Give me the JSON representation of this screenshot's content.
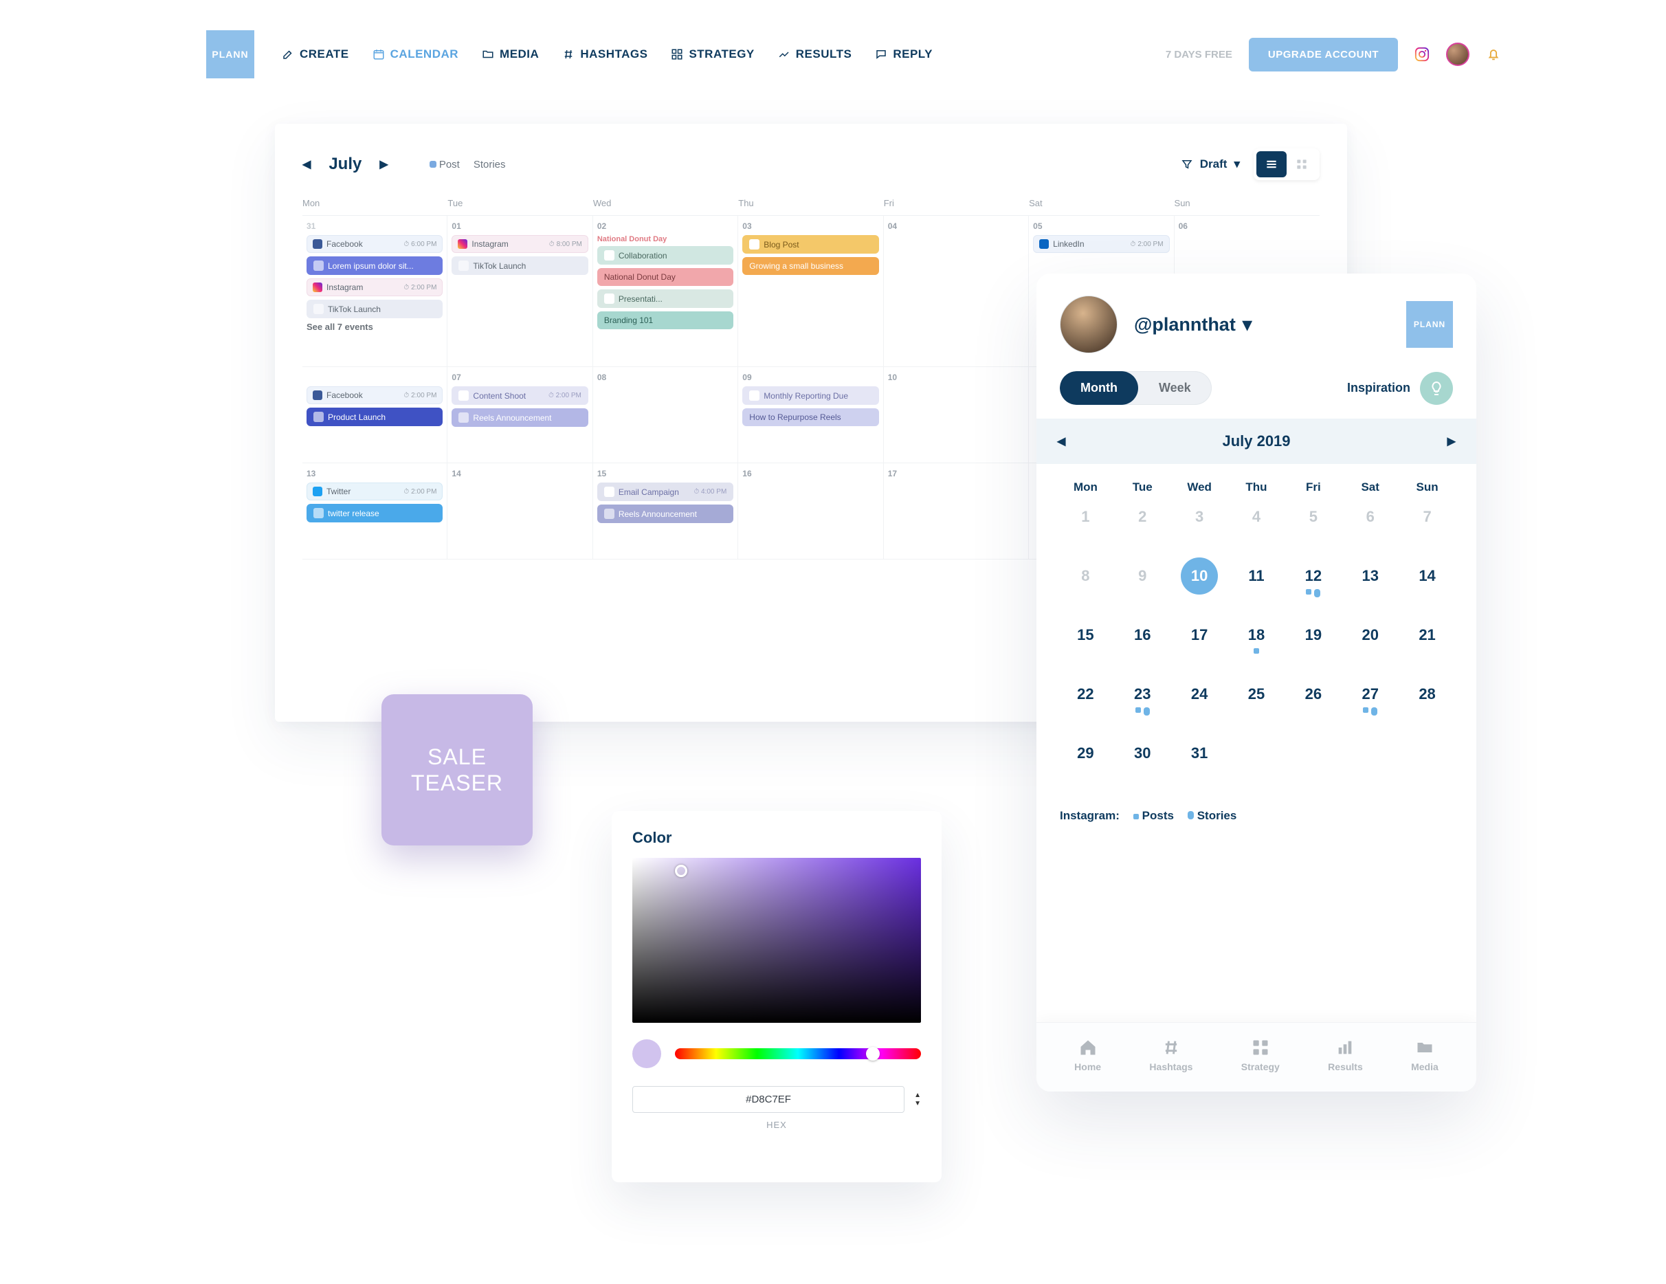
{
  "brand": "PLANN",
  "nav": {
    "create": "CREATE",
    "calendar": "CALENDAR",
    "media": "MEDIA",
    "hashtags": "HASHTAGS",
    "strategy": "STRATEGY",
    "results": "RESULTS",
    "reply": "REPLY"
  },
  "trial_prefix": "7 DAYS",
  "trial_suffix": "FREE",
  "upgrade": "UPGRADE ACCOUNT",
  "calendar": {
    "month_label": "July",
    "legend_post": "Post",
    "legend_stories": "Stories",
    "filter_label": "Draft",
    "weekdays": [
      "Mon",
      "Tue",
      "Wed",
      "Thu",
      "Fri",
      "Sat",
      "Sun"
    ],
    "see_all": "See all 7 events"
  },
  "cells": {
    "d31": "31",
    "d01": "01",
    "d02": "02",
    "d03": "03",
    "d04": "04",
    "d05": "05",
    "d06": "06",
    "d07": "07",
    "d08": "08",
    "d09": "09",
    "d10": "10",
    "d13": "13",
    "d14": "14",
    "d15": "15",
    "d16": "16",
    "d17": "17"
  },
  "events": {
    "fb1": "Facebook",
    "fb1_t": "6:00 PM",
    "lorem": "Lorem ipsum dolor sit...",
    "ig1": "Instagram",
    "ig1_t": "2:00 PM",
    "tiktok1": "TikTok Launch",
    "ig2": "Instagram",
    "ig2_t": "8:00 PM",
    "tiktok2": "TikTok Launch",
    "holiday": "National Donut Day",
    "collab": "Collaboration",
    "donut_pill": "National Donut Day",
    "present": "Presentati...",
    "brand101": "Branding 101",
    "blog": "Blog Post",
    "grow": "Growing a small business",
    "li": "LinkedIn",
    "li_t": "2:00 PM",
    "fb2": "Facebook",
    "fb2_t": "2:00 PM",
    "product_launch": "Product Launch",
    "shoot": "Content Shoot",
    "shoot_t": "2:00 PM",
    "reels1": "Reels Announcement",
    "monthly": "Monthly Reporting Due",
    "repurpose": "How to Repurpose Reels",
    "tw": "Twitter",
    "tw_t": "2:00 PM",
    "tw_rel": "twitter release",
    "email": "Email Campaign",
    "email_t": "4:00 PM",
    "reels2": "Reels Announcement"
  },
  "sale_teaser_line1": "SALE",
  "sale_teaser_line2": "TEASER",
  "color": {
    "title": "Color",
    "hex": "#D8C7EF",
    "format_label": "HEX"
  },
  "mobile": {
    "username": "@plannthat",
    "month_label": "Month",
    "week_label": "Week",
    "inspiration": "Inspiration",
    "month_title": "July 2019",
    "weekdays": [
      "Mon",
      "Tue",
      "Wed",
      "Thu",
      "Fri",
      "Sat",
      "Sun"
    ],
    "legend_prefix": "Instagram:",
    "legend_posts": "Posts",
    "legend_stories": "Stories",
    "nav": {
      "home": "Home",
      "hashtags": "Hashtags",
      "strategy": "Strategy",
      "results": "Results",
      "media": "Media"
    },
    "days": [
      1,
      2,
      3,
      4,
      5,
      6,
      7,
      8,
      9,
      10,
      11,
      12,
      13,
      14,
      15,
      16,
      17,
      18,
      19,
      20,
      21,
      22,
      23,
      24,
      25,
      26,
      27,
      28,
      29,
      30,
      31
    ]
  }
}
